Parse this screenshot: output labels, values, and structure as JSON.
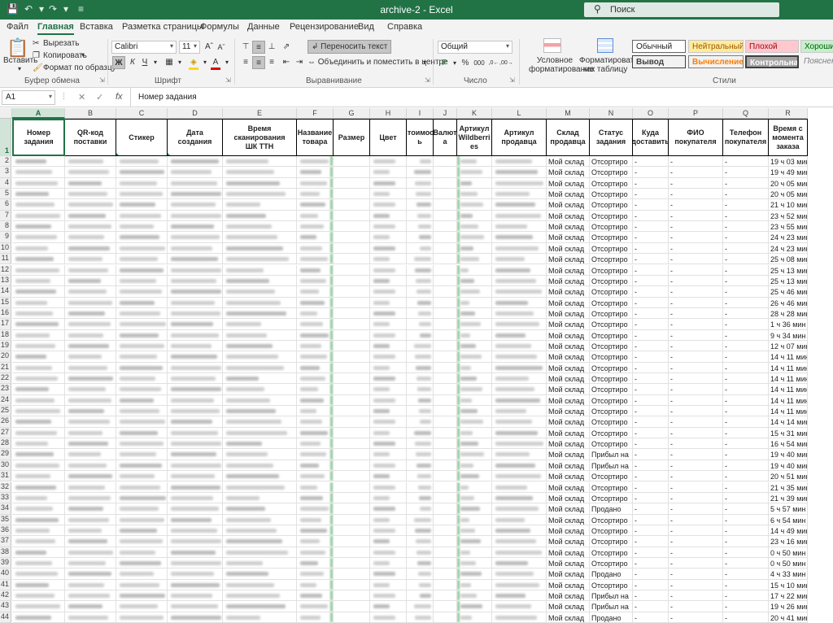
{
  "window": {
    "title": "archive-2  -  Excel",
    "search_placeholder": "Поиск",
    "save_icon": "save-icon",
    "undo_icon": "undo-icon",
    "redo_icon": "redo-icon"
  },
  "menu": {
    "tabs": [
      "Файл",
      "Главная",
      "Вставка",
      "Разметка страницы",
      "Формулы",
      "Данные",
      "Рецензирование",
      "Вид",
      "Справка"
    ],
    "active": "Главная"
  },
  "ribbon": {
    "clipboard": {
      "paste": "Вставить",
      "cut": "Вырезать",
      "copy": "Копировать",
      "format_painter": "Формат по образцу",
      "group": "Буфер обмена"
    },
    "font": {
      "name": "Calibri",
      "size": "11",
      "group": "Шрифт"
    },
    "alignment": {
      "wrap": "Переносить текст",
      "merge": "Объединить и поместить в центре",
      "group": "Выравнивание"
    },
    "number": {
      "format": "Общий",
      "group": "Число"
    },
    "styles": {
      "conditional": "Условное форматирование",
      "conditional_l1": "Условное",
      "conditional_l2": "форматирование",
      "table": "Форматировать как таблицу",
      "table_l1": "Форматировать",
      "table_l2": "как таблицу",
      "cells": [
        "Обычный",
        "Нейтральный",
        "Плохой",
        "Хороший",
        "Вывод",
        "Вычисление",
        "Контрольна...",
        "Пояснени"
      ],
      "group": "Стили"
    },
    "colors": {
      "accent": "#217346",
      "neutral_bg": "#ffeb9c",
      "bad_bg": "#ffc7ce",
      "good_bg": "#c6efce"
    }
  },
  "formula_bar": {
    "name_box": "A1",
    "fx": "fx",
    "value": "Номер задания"
  },
  "sheet": {
    "columns": [
      "A",
      "B",
      "C",
      "D",
      "E",
      "F",
      "G",
      "H",
      "I",
      "J",
      "K",
      "L",
      "M",
      "N",
      "O",
      "P",
      "Q",
      "R"
    ],
    "headers": [
      "Номер задания",
      "QR-код поставки",
      "Стикер",
      "Дата создания",
      "Время сканирования ШК ТТН",
      "Название товара",
      "Размер",
      "Цвет",
      "Стоимость",
      "Валюта",
      "Артикул Wildberries",
      "Артикул продавца",
      "Склад продавца",
      "Статус задания",
      "Куда доставить",
      "ФИО покупателя",
      "Телефон покупателя",
      "Время с момента заказа"
    ],
    "header_lines": [
      [
        "Номер",
        "задания"
      ],
      [
        "QR-код",
        "поставки"
      ],
      [
        "Стикер"
      ],
      [
        "Дата создания"
      ],
      [
        "Время сканирования",
        "ШК ТТН"
      ],
      [
        "Название",
        "товара"
      ],
      [
        "Размер"
      ],
      [
        "Цвет"
      ],
      [
        "Стоимост",
        "ь"
      ],
      [
        "Валют",
        "а"
      ],
      [
        "Артикул",
        "Wildberri",
        "es"
      ],
      [
        "Артикул",
        "продавца"
      ],
      [
        "Склад",
        "продавца"
      ],
      [
        "Статус",
        "задания"
      ],
      [
        "Куда",
        "доставить"
      ],
      [
        "ФИО",
        "покупателя"
      ],
      [
        "Телефон",
        "покупателя"
      ],
      [
        "Время с",
        "момента",
        "заказа"
      ]
    ],
    "rows": [
      {
        "n": 2,
        "wh": "Мой склад",
        "st": "Отсортиро",
        "d": "-",
        "f": "-",
        "p": "-",
        "t": "19 ч 03 мин"
      },
      {
        "n": 3,
        "wh": "Мой склад",
        "st": "Отсортиро",
        "d": "-",
        "f": "-",
        "p": "-",
        "t": "19 ч 49 мин"
      },
      {
        "n": 4,
        "wh": "Мой склад",
        "st": "Отсортиро",
        "d": "-",
        "f": "-",
        "p": "-",
        "t": "20 ч 05 мин"
      },
      {
        "n": 5,
        "wh": "Мой склад",
        "st": "Отсортиро",
        "d": "-",
        "f": "-",
        "p": "-",
        "t": "20 ч 05 мин"
      },
      {
        "n": 6,
        "wh": "Мой склад",
        "st": "Отсортиро",
        "d": "-",
        "f": "-",
        "p": "-",
        "t": "21 ч 10 мин"
      },
      {
        "n": 7,
        "wh": "Мой склад",
        "st": "Отсортиро",
        "d": "-",
        "f": "-",
        "p": "-",
        "t": "23 ч 52 мин"
      },
      {
        "n": 8,
        "wh": "Мой склад",
        "st": "Отсортиро",
        "d": "-",
        "f": "-",
        "p": "-",
        "t": "23 ч 55 мин"
      },
      {
        "n": 9,
        "wh": "Мой склад",
        "st": "Отсортиро",
        "d": "-",
        "f": "-",
        "p": "-",
        "t": "24 ч 23 мин"
      },
      {
        "n": 10,
        "wh": "Мой склад",
        "st": "Отсортиро",
        "d": "-",
        "f": "-",
        "p": "-",
        "t": "24 ч 23 мин"
      },
      {
        "n": 11,
        "wh": "Мой склад",
        "st": "Отсортиро",
        "d": "-",
        "f": "-",
        "p": "-",
        "t": "25 ч 08 мин"
      },
      {
        "n": 12,
        "wh": "Мой склад",
        "st": "Отсортиро",
        "d": "-",
        "f": "-",
        "p": "-",
        "t": "25 ч 13 мин"
      },
      {
        "n": 13,
        "wh": "Мой склад",
        "st": "Отсортиро",
        "d": "-",
        "f": "-",
        "p": "-",
        "t": "25 ч 13 мин"
      },
      {
        "n": 14,
        "wh": "Мой склад",
        "st": "Отсортиро",
        "d": "-",
        "f": "-",
        "p": "-",
        "t": "25 ч 46 мин"
      },
      {
        "n": 15,
        "wh": "Мой склад",
        "st": "Отсортиро",
        "d": "-",
        "f": "-",
        "p": "-",
        "t": "26 ч 46 мин"
      },
      {
        "n": 16,
        "wh": "Мой склад",
        "st": "Отсортиро",
        "d": "-",
        "f": "-",
        "p": "-",
        "t": "28 ч 28 мин"
      },
      {
        "n": 17,
        "wh": "Мой склад",
        "st": "Отсортиро",
        "d": "-",
        "f": "-",
        "p": "-",
        "t": "1 ч 36 мин"
      },
      {
        "n": 18,
        "wh": "Мой склад",
        "st": "Отсортиро",
        "d": "-",
        "f": "-",
        "p": "-",
        "t": "9 ч 34 мин"
      },
      {
        "n": 19,
        "wh": "Мой склад",
        "st": "Отсортиро",
        "d": "-",
        "f": "-",
        "p": "-",
        "t": "12 ч 07 мин"
      },
      {
        "n": 20,
        "wh": "Мой склад",
        "st": "Отсортиро",
        "d": "-",
        "f": "-",
        "p": "-",
        "t": "14 ч 11 мин"
      },
      {
        "n": 21,
        "wh": "Мой склад",
        "st": "Отсортиро",
        "d": "-",
        "f": "-",
        "p": "-",
        "t": "14 ч 11 мин"
      },
      {
        "n": 22,
        "wh": "Мой склад",
        "st": "Отсортиро",
        "d": "-",
        "f": "-",
        "p": "-",
        "t": "14 ч 11 мин"
      },
      {
        "n": 23,
        "wh": "Мой склад",
        "st": "Отсортиро",
        "d": "-",
        "f": "-",
        "p": "-",
        "t": "14 ч 11 мин"
      },
      {
        "n": 24,
        "wh": "Мой склад",
        "st": "Отсортиро",
        "d": "-",
        "f": "-",
        "p": "-",
        "t": "14 ч 11 мин"
      },
      {
        "n": 25,
        "wh": "Мой склад",
        "st": "Отсортиро",
        "d": "-",
        "f": "-",
        "p": "-",
        "t": "14 ч 11 мин"
      },
      {
        "n": 26,
        "wh": "Мой склад",
        "st": "Отсортиро",
        "d": "-",
        "f": "-",
        "p": "-",
        "t": "14 ч 14 мин"
      },
      {
        "n": 27,
        "wh": "Мой склад",
        "st": "Отсортиро",
        "d": "-",
        "f": "-",
        "p": "-",
        "t": "15 ч 31 мин"
      },
      {
        "n": 28,
        "wh": "Мой склад",
        "st": "Отсортиро",
        "d": "-",
        "f": "-",
        "p": "-",
        "t": "16 ч 54 мин"
      },
      {
        "n": 29,
        "wh": "Мой склад",
        "st": "Прибыл на",
        "d": "-",
        "f": "-",
        "p": "-",
        "t": "19 ч 40 мин"
      },
      {
        "n": 30,
        "wh": "Мой склад",
        "st": "Прибыл на",
        "d": "-",
        "f": "-",
        "p": "-",
        "t": "19 ч 40 мин"
      },
      {
        "n": 31,
        "wh": "Мой склад",
        "st": "Отсортиро",
        "d": "-",
        "f": "-",
        "p": "-",
        "t": "20 ч 51 мин"
      },
      {
        "n": 32,
        "wh": "Мой склад",
        "st": "Отсортиро",
        "d": "-",
        "f": "-",
        "p": "-",
        "t": "21 ч 35 мин"
      },
      {
        "n": 33,
        "wh": "Мой склад",
        "st": "Отсортиро",
        "d": "-",
        "f": "-",
        "p": "-",
        "t": "21 ч 39 мин"
      },
      {
        "n": 34,
        "wh": "Мой склад",
        "st": "Продано",
        "d": "-",
        "f": "-",
        "p": "-",
        "t": "5 ч 57 мин"
      },
      {
        "n": 35,
        "wh": "Мой склад",
        "st": "Отсортиро",
        "d": "-",
        "f": "-",
        "p": "-",
        "t": "6 ч 54 мин"
      },
      {
        "n": 36,
        "wh": "Мой склад",
        "st": "Отсортиро",
        "d": "-",
        "f": "-",
        "p": "-",
        "t": "14 ч 49 мин"
      },
      {
        "n": 37,
        "wh": "Мой склад",
        "st": "Отсортиро",
        "d": "-",
        "f": "-",
        "p": "-",
        "t": "23 ч 16 мин"
      },
      {
        "n": 38,
        "wh": "Мой склад",
        "st": "Отсортиро",
        "d": "-",
        "f": "-",
        "p": "-",
        "t": "0 ч 50 мин"
      },
      {
        "n": 39,
        "wh": "Мой склад",
        "st": "Отсортиро",
        "d": "-",
        "f": "-",
        "p": "-",
        "t": "0 ч 50 мин"
      },
      {
        "n": 40,
        "wh": "Мой склад",
        "st": "Продано",
        "d": "-",
        "f": "-",
        "p": "-",
        "t": "4 ч 33 мин"
      },
      {
        "n": 41,
        "wh": "Мой склад",
        "st": "Отсортиро",
        "d": "-",
        "f": "-",
        "p": "-",
        "t": "15 ч 10 мин"
      },
      {
        "n": 42,
        "wh": "Мой склад",
        "st": "Прибыл на",
        "d": "-",
        "f": "-",
        "p": "-",
        "t": "17 ч 22 мин"
      },
      {
        "n": 43,
        "wh": "Мой склад",
        "st": "Прибыл на",
        "d": "-",
        "f": "-",
        "p": "-",
        "t": "19 ч 26 мин"
      },
      {
        "n": 44,
        "wh": "Мой склад",
        "st": "Продано",
        "d": "-",
        "f": "-",
        "p": "-",
        "t": "20 ч 41 мин"
      }
    ]
  }
}
